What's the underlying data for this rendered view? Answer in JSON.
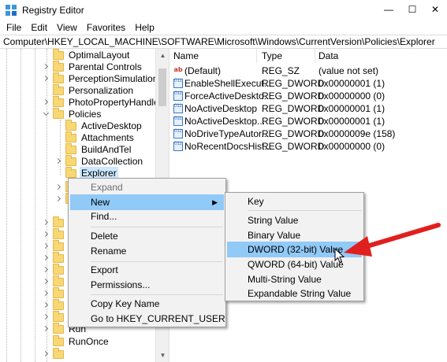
{
  "window": {
    "title": "Registry Editor",
    "minimize": "—",
    "maximize": "☐",
    "close": "✕"
  },
  "menubar": [
    "File",
    "Edit",
    "View",
    "Favorites",
    "Help"
  ],
  "address": "Computer\\HKEY_LOCAL_MACHINE\\SOFTWARE\\Microsoft\\Windows\\CurrentVersion\\Policies\\Explorer",
  "tree": {
    "items": [
      {
        "label": "OptimalLayout"
      },
      {
        "label": "Parental Controls"
      },
      {
        "label": "PerceptionSimulationExt"
      },
      {
        "label": "Personalization"
      },
      {
        "label": "PhotoPropertyHandler"
      },
      {
        "label": "Policies"
      },
      {
        "label": "ActiveDesktop"
      },
      {
        "label": "Attachments"
      },
      {
        "label": "BuildAndTel"
      },
      {
        "label": "DataCollection"
      },
      {
        "label": "Explorer"
      },
      {
        "label": "Run"
      },
      {
        "label": "RunOnce"
      }
    ]
  },
  "list": {
    "headers": {
      "name": "Name",
      "type": "Type",
      "data": "Data"
    },
    "rows": [
      {
        "icon": "string-value-icon",
        "name": "(Default)",
        "type": "REG_SZ",
        "data": "(value not set)"
      },
      {
        "icon": "dword-value-icon",
        "name": "EnableShellExecut...",
        "type": "REG_DWORD",
        "data": "0x00000001 (1)"
      },
      {
        "icon": "dword-value-icon",
        "name": "ForceActiveDeskto...",
        "type": "REG_DWORD",
        "data": "0x00000000 (0)"
      },
      {
        "icon": "dword-value-icon",
        "name": "NoActiveDesktop",
        "type": "REG_DWORD",
        "data": "0x00000001 (1)"
      },
      {
        "icon": "dword-value-icon",
        "name": "NoActiveDesktop...",
        "type": "REG_DWORD",
        "data": "0x00000001 (1)"
      },
      {
        "icon": "dword-value-icon",
        "name": "NoDriveTypeAutor...",
        "type": "REG_DWORD",
        "data": "0x0000009e (158)"
      },
      {
        "icon": "dword-value-icon",
        "name": "NoRecentDocsHist...",
        "type": "REG_DWORD",
        "data": "0x00000000 (0)"
      }
    ]
  },
  "context_menu": {
    "items": [
      {
        "label": "Expand"
      },
      {
        "label": "New"
      },
      {
        "label": "Find..."
      },
      {
        "label": "Delete"
      },
      {
        "label": "Rename"
      },
      {
        "label": "Export"
      },
      {
        "label": "Permissions..."
      },
      {
        "label": "Copy Key Name"
      },
      {
        "label": "Go to HKEY_CURRENT_USER"
      }
    ],
    "submenu_arrow": "▶"
  },
  "submenu": {
    "items": [
      {
        "label": "Key"
      },
      {
        "label": "String Value"
      },
      {
        "label": "Binary Value"
      },
      {
        "label": "DWORD (32-bit) Value"
      },
      {
        "label": "QWORD (64-bit) Value"
      },
      {
        "label": "Multi-String Value"
      },
      {
        "label": "Expandable String Value"
      }
    ]
  },
  "colors": {
    "highlight": "#91c9f7",
    "tree_selected": "#cce8ff",
    "annotation_arrow": "#e0201e",
    "folder": "#f8d775"
  },
  "icons": {
    "string": "ab",
    "dword": "011"
  }
}
